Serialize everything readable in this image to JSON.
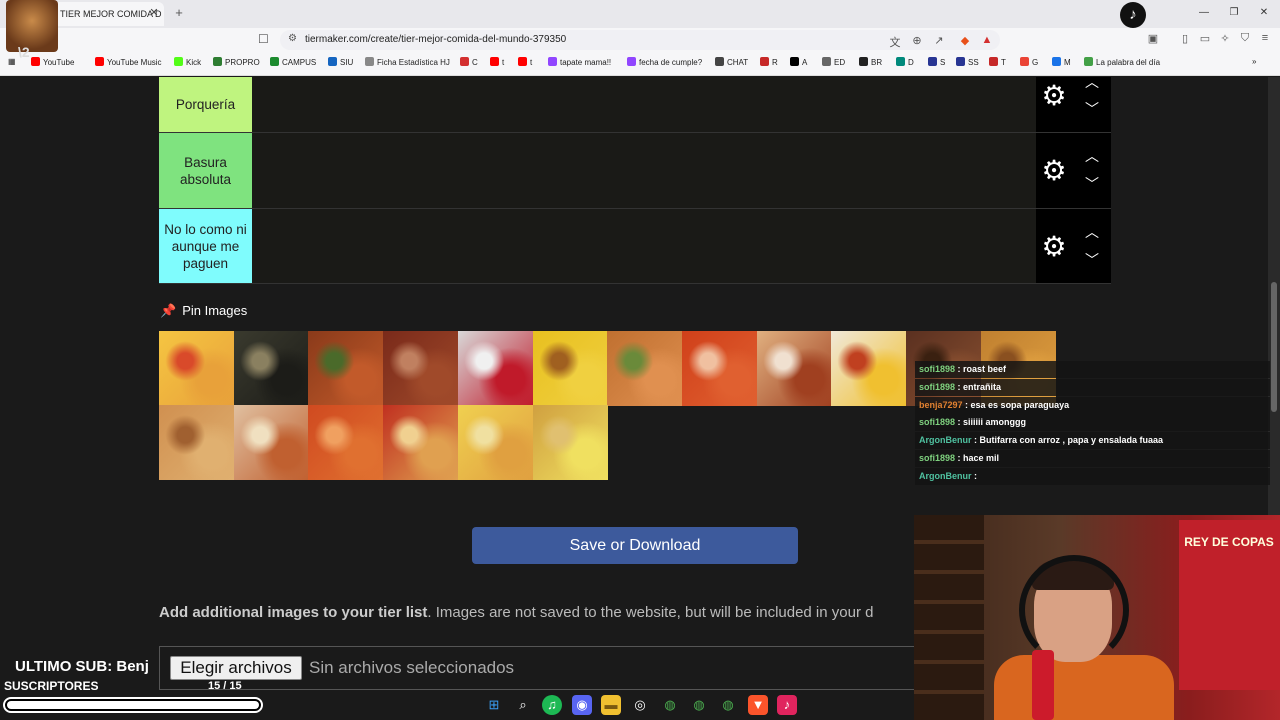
{
  "browser": {
    "tab_title": "TIER MEJOR COMIDA D",
    "url": "tiermaker.com/create/tier-mejor-comida-del-mundo-379350",
    "bookmarks": [
      {
        "label": "YouTube",
        "color": "#ff0000"
      },
      {
        "label": "YouTube Music",
        "color": "#ff0000"
      },
      {
        "label": "Kick",
        "color": "#53fc18"
      },
      {
        "label": "PROPRO",
        "color": "#2e7d32"
      },
      {
        "label": "CAMPUS",
        "color": "#1b8a2e"
      },
      {
        "label": "SIU",
        "color": "#1565c0"
      },
      {
        "label": "Ficha Estadística HJ",
        "color": "#888888"
      },
      {
        "label": "C",
        "color": "#d32f2f"
      },
      {
        "label": "t",
        "color": "#ff0000"
      },
      {
        "label": "t",
        "color": "#ff0000"
      },
      {
        "label": "tapate mama!!",
        "color": "#9146ff"
      },
      {
        "label": "fecha de cumple?",
        "color": "#9146ff"
      },
      {
        "label": "CHAT",
        "color": "#444444"
      },
      {
        "label": "R",
        "color": "#c62828"
      },
      {
        "label": "A",
        "color": "#000000"
      },
      {
        "label": "ED",
        "color": "#666666"
      },
      {
        "label": "BR",
        "color": "#222222"
      },
      {
        "label": "D",
        "color": "#00897b"
      },
      {
        "label": "S",
        "color": "#283593"
      },
      {
        "label": "SS",
        "color": "#283593"
      },
      {
        "label": "T",
        "color": "#c62828"
      },
      {
        "label": "G",
        "color": "#ea4335"
      },
      {
        "label": "M",
        "color": "#1a73e8"
      },
      {
        "label": "La palabra del día",
        "color": "#43a047"
      }
    ]
  },
  "overlay": {
    "avatar_label": "\\2"
  },
  "tiers": [
    {
      "label": "Porquería",
      "color": "#bff47f"
    },
    {
      "label": "Basura absoluta",
      "color": "#7fe37f"
    },
    {
      "label": "No lo como ni aunque me paguen",
      "color": "#7ffcfd"
    }
  ],
  "pin_images": {
    "heading": "Pin Images",
    "images": [
      {
        "name": "pizza-pineapple",
        "colors": [
          "#f5c542",
          "#e8a13a",
          "#d94a2a"
        ]
      },
      {
        "name": "dark-dish",
        "colors": [
          "#3a3a2e",
          "#1c1c18",
          "#8a8060"
        ]
      },
      {
        "name": "chicken-wings",
        "colors": [
          "#8a3a1a",
          "#c25a2a",
          "#4a6a2a"
        ]
      },
      {
        "name": "bacon-dates",
        "colors": [
          "#7a2a1a",
          "#a04a2a",
          "#c08060"
        ]
      },
      {
        "name": "cherry-candy",
        "colors": [
          "#d8d8d8",
          "#c01a2a",
          "#f0f0f0"
        ]
      },
      {
        "name": "paella",
        "colors": [
          "#e8c020",
          "#f0d040",
          "#a06020"
        ]
      },
      {
        "name": "grilled-chicken",
        "colors": [
          "#c07030",
          "#e09050",
          "#6a8a3a"
        ]
      },
      {
        "name": "gazpacho",
        "colors": [
          "#d0401a",
          "#e06030",
          "#f0c0a0"
        ]
      },
      {
        "name": "hotdog",
        "colors": [
          "#e0b080",
          "#a04020",
          "#f0e0d0"
        ]
      },
      {
        "name": "eggs-bacon",
        "colors": [
          "#f0e8d8",
          "#f0c030",
          "#c04020"
        ]
      },
      {
        "name": "roast",
        "colors": [
          "#5a3020",
          "#8a5030",
          "#3a2010"
        ]
      },
      {
        "name": "toast",
        "colors": [
          "#c08030",
          "#e0a040",
          "#8a5020"
        ]
      },
      {
        "name": "breadsticks",
        "colors": [
          "#d09050",
          "#e0b070",
          "#a06030"
        ]
      },
      {
        "name": "lasagna",
        "colors": [
          "#e0c0a0",
          "#c06030",
          "#f0e0c0"
        ]
      },
      {
        "name": "pizza-squares",
        "colors": [
          "#d04a20",
          "#e07030",
          "#f0a060"
        ]
      },
      {
        "name": "pepperoni-pizza",
        "colors": [
          "#c03020",
          "#e0a050",
          "#f0d090"
        ]
      },
      {
        "name": "pineapple-pizza",
        "colors": [
          "#f0d050",
          "#e0a040",
          "#f0e0a0"
        ]
      },
      {
        "name": "milanesa",
        "colors": [
          "#d0a040",
          "#f0e060",
          "#e0c070"
        ]
      }
    ]
  },
  "chat": [
    {
      "user": "sofi1898",
      "user_color": "#7fd17f",
      "message": "roast beef"
    },
    {
      "user": "sofi1898",
      "user_color": "#7fd17f",
      "message": "entrañita"
    },
    {
      "user": "benja7297",
      "user_color": "#e08030",
      "message": "esa es sopa paraguaya"
    },
    {
      "user": "sofi1898",
      "user_color": "#7fd17f",
      "message": "siiiiii amonggg"
    },
    {
      "user": "ArgonBenur",
      "user_color": "#4fc1a0",
      "message": "Butifarra con arroz , papa y ensalada fuaaa"
    },
    {
      "user": "sofi1898",
      "user_color": "#7fd17f",
      "message": "hace mil"
    },
    {
      "user": "ArgonBenur",
      "user_color": "#4fc1a0",
      "message": ""
    }
  ],
  "save_button": "Save or Download",
  "add_images": {
    "bold": "Add additional images to your tier list",
    "rest": ". Images are not saved to the website, but will be included in your d"
  },
  "file_input": {
    "button": "Elegir archivos",
    "status": "Sin archivos seleccionados"
  },
  "stream_overlay": {
    "ultimo_sub": "ULTIMO SUB: Benj",
    "suscriptores": "SUSCRIPTORES",
    "count": "15 / 15",
    "progress": 1.0
  },
  "webcam": {
    "flag_text": "REY DE COPAS"
  }
}
